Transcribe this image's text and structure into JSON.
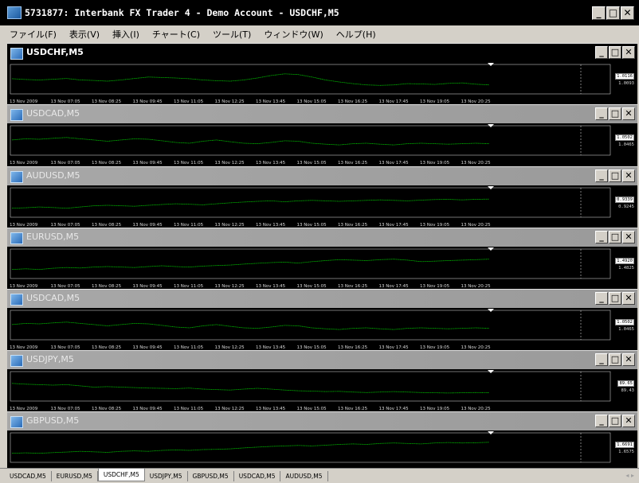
{
  "window": {
    "title": "5731877: Interbank FX Trader 4 - Demo Account - USDCHF,M5",
    "minimize": "_",
    "maximize": "□",
    "close": "✕"
  },
  "menu": [
    "ファイル(F)",
    "表示(V)",
    "挿入(I)",
    "チャート(C)",
    "ツール(T)",
    "ウィンドウ(W)",
    "ヘルプ(H)"
  ],
  "time_ticks": [
    "13 Nov 2009",
    "13 Nov 07:05",
    "13 Nov 08:25",
    "13 Nov 09:45",
    "13 Nov 11:05",
    "13 Nov 12:25",
    "13 Nov 13:45",
    "13 Nov 15:05",
    "13 Nov 16:25",
    "13 Nov 17:45",
    "13 Nov 19:05",
    "13 Nov 20:25"
  ],
  "charts": [
    {
      "title": "USDCHF,M5",
      "active": true,
      "price_top": "1.0116",
      "price_bottom": "1.0093",
      "series": [
        0.55,
        0.52,
        0.5,
        0.53,
        0.56,
        0.5,
        0.48,
        0.45,
        0.5,
        0.56,
        0.62,
        0.6,
        0.58,
        0.55,
        0.5,
        0.47,
        0.45,
        0.5,
        0.58,
        0.68,
        0.75,
        0.72,
        0.62,
        0.5,
        0.42,
        0.35,
        0.3,
        0.28,
        0.3,
        0.35,
        0.34,
        0.32,
        0.36,
        0.38,
        0.33,
        0.3
      ]
    },
    {
      "title": "USDCAD,M5",
      "active": false,
      "price_top": "1.0502",
      "price_bottom": "1.0465",
      "series": [
        0.55,
        0.6,
        0.58,
        0.62,
        0.65,
        0.6,
        0.55,
        0.5,
        0.55,
        0.6,
        0.58,
        0.52,
        0.45,
        0.42,
        0.5,
        0.55,
        0.48,
        0.42,
        0.4,
        0.45,
        0.52,
        0.5,
        0.42,
        0.38,
        0.35,
        0.4,
        0.42,
        0.38,
        0.35,
        0.4,
        0.42,
        0.4,
        0.38,
        0.4,
        0.42,
        0.4
      ]
    },
    {
      "title": "AUDUSD,M5",
      "active": false,
      "price_top": "0.9339",
      "price_bottom": "0.9245",
      "series": [
        0.3,
        0.32,
        0.35,
        0.33,
        0.3,
        0.35,
        0.4,
        0.42,
        0.4,
        0.38,
        0.42,
        0.45,
        0.48,
        0.46,
        0.44,
        0.48,
        0.52,
        0.55,
        0.58,
        0.6,
        0.56,
        0.6,
        0.62,
        0.6,
        0.58,
        0.6,
        0.62,
        0.64,
        0.62,
        0.6,
        0.63,
        0.65,
        0.66,
        0.64,
        0.66,
        0.67
      ]
    },
    {
      "title": "EURUSD,M5",
      "active": false,
      "price_top": "1.4920",
      "price_bottom": "1.4825",
      "series": [
        0.3,
        0.33,
        0.3,
        0.35,
        0.38,
        0.36,
        0.4,
        0.42,
        0.4,
        0.38,
        0.42,
        0.45,
        0.42,
        0.4,
        0.44,
        0.46,
        0.48,
        0.52,
        0.55,
        0.58,
        0.6,
        0.56,
        0.62,
        0.66,
        0.7,
        0.68,
        0.66,
        0.7,
        0.72,
        0.68,
        0.62,
        0.64,
        0.66,
        0.68,
        0.7,
        0.72
      ]
    },
    {
      "title": "USDCAD,M5",
      "active": false,
      "price_top": "1.0502",
      "price_bottom": "1.0465",
      "series": [
        0.55,
        0.6,
        0.58,
        0.62,
        0.65,
        0.6,
        0.55,
        0.5,
        0.55,
        0.6,
        0.58,
        0.52,
        0.45,
        0.42,
        0.5,
        0.55,
        0.48,
        0.42,
        0.4,
        0.45,
        0.52,
        0.5,
        0.42,
        0.38,
        0.35,
        0.4,
        0.42,
        0.38,
        0.35,
        0.4,
        0.42,
        0.4,
        0.38,
        0.4,
        0.42,
        0.4
      ]
    },
    {
      "title": "USDJPY,M5",
      "active": false,
      "price_top": "89.65",
      "price_bottom": "89.43",
      "series": [
        0.65,
        0.62,
        0.6,
        0.58,
        0.6,
        0.55,
        0.5,
        0.52,
        0.5,
        0.48,
        0.46,
        0.45,
        0.44,
        0.46,
        0.42,
        0.4,
        0.38,
        0.42,
        0.45,
        0.42,
        0.38,
        0.35,
        0.34,
        0.32,
        0.33,
        0.3,
        0.28,
        0.3,
        0.32,
        0.3,
        0.28,
        0.27,
        0.26,
        0.27,
        0.28,
        0.27
      ]
    },
    {
      "title": "GBPUSD,M5",
      "active": false,
      "price_top": "1.6691",
      "price_bottom": "1.6575",
      "series": [
        0.3,
        0.32,
        0.3,
        0.33,
        0.35,
        0.38,
        0.36,
        0.34,
        0.38,
        0.4,
        0.38,
        0.42,
        0.44,
        0.42,
        0.45,
        0.46,
        0.48,
        0.52,
        0.55,
        0.58,
        0.6,
        0.62,
        0.6,
        0.63,
        0.66,
        0.68,
        0.66,
        0.7,
        0.72,
        0.7,
        0.68,
        0.72,
        0.74,
        0.72,
        0.73,
        0.75
      ]
    }
  ],
  "tabs": [
    "USDCAD,M5",
    "EURUSD,M5",
    "USDCHF,M5",
    "USDJPY,M5",
    "GBPUSD,M5",
    "USDCAD,M5",
    "AUDUSD,M5"
  ],
  "selected_tab": 2,
  "colors": {
    "line": "#00c000",
    "grid_bg": "#000000",
    "marker": "#ffffff"
  }
}
